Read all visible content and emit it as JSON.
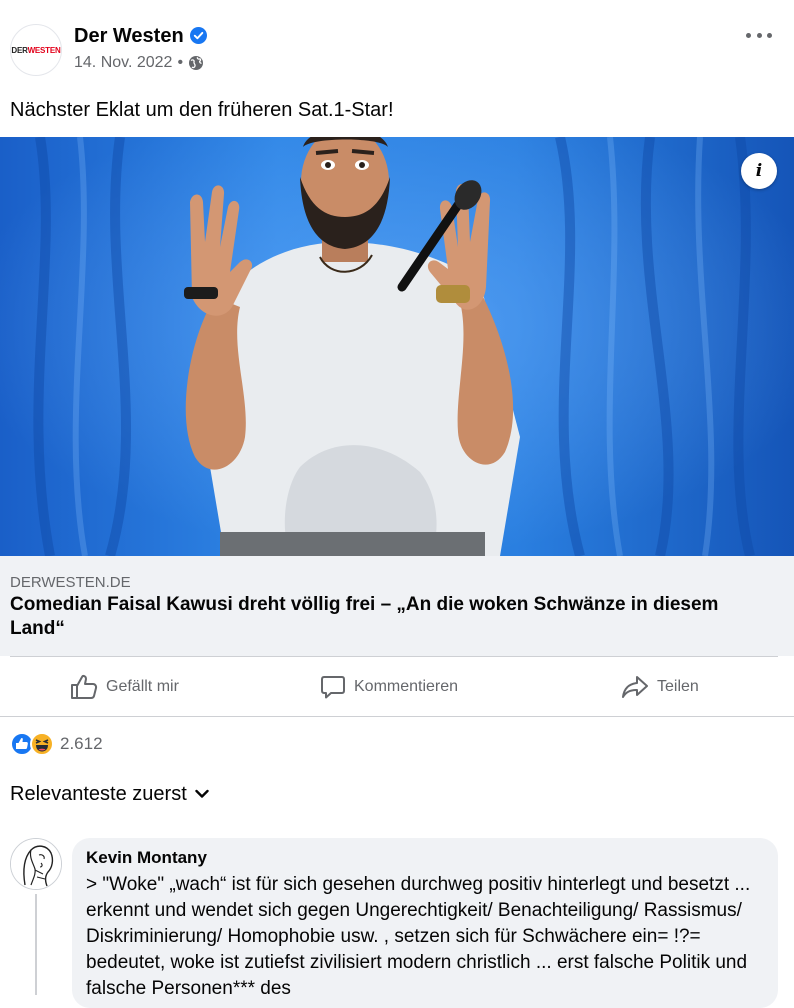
{
  "post": {
    "page_name": "Der Westen",
    "page_logo": {
      "part1": "DER",
      "part2": "WESTEN"
    },
    "date": "14. Nov. 2022",
    "separator": "•",
    "text": "Nächster Eklat um den früheren Sat.1-Star!",
    "verified_color": "#1877f2"
  },
  "link_card": {
    "domain": "DERWESTEN.DE",
    "title": "Comedian Faisal Kawusi dreht völlig frei – „An die woken Schwänze in diesem Land“"
  },
  "actions": {
    "like_label": "Gefällt mir",
    "comment_label": "Kommentieren",
    "share_label": "Teilen"
  },
  "reactions": {
    "types": [
      "like-icon",
      "haha-icon"
    ],
    "count": "2.612"
  },
  "comments_sort": {
    "label": "Relevanteste zuerst"
  },
  "comment": {
    "author": "Kevin Montany",
    "text": "> \"Woke\" „wach“ ist für sich gesehen durchweg positiv hinterlegt und besetzt ... erkennt und wendet sich gegen  Ungerechtigkeit/ Benachteiligung/ Rassismus/ Diskriminierung/ Homophobie usw. , setzen sich für Schwächere ein= !?= bedeutet, woke ist  zutiefst zivilisiert modern christlich ... erst falsche Politik  und falsche Personen*** des"
  },
  "colors": {
    "accent": "#1877f2",
    "muted_text": "#65676b",
    "card_bg": "#f0f2f5",
    "stage_blue": "#1f6fd6"
  }
}
